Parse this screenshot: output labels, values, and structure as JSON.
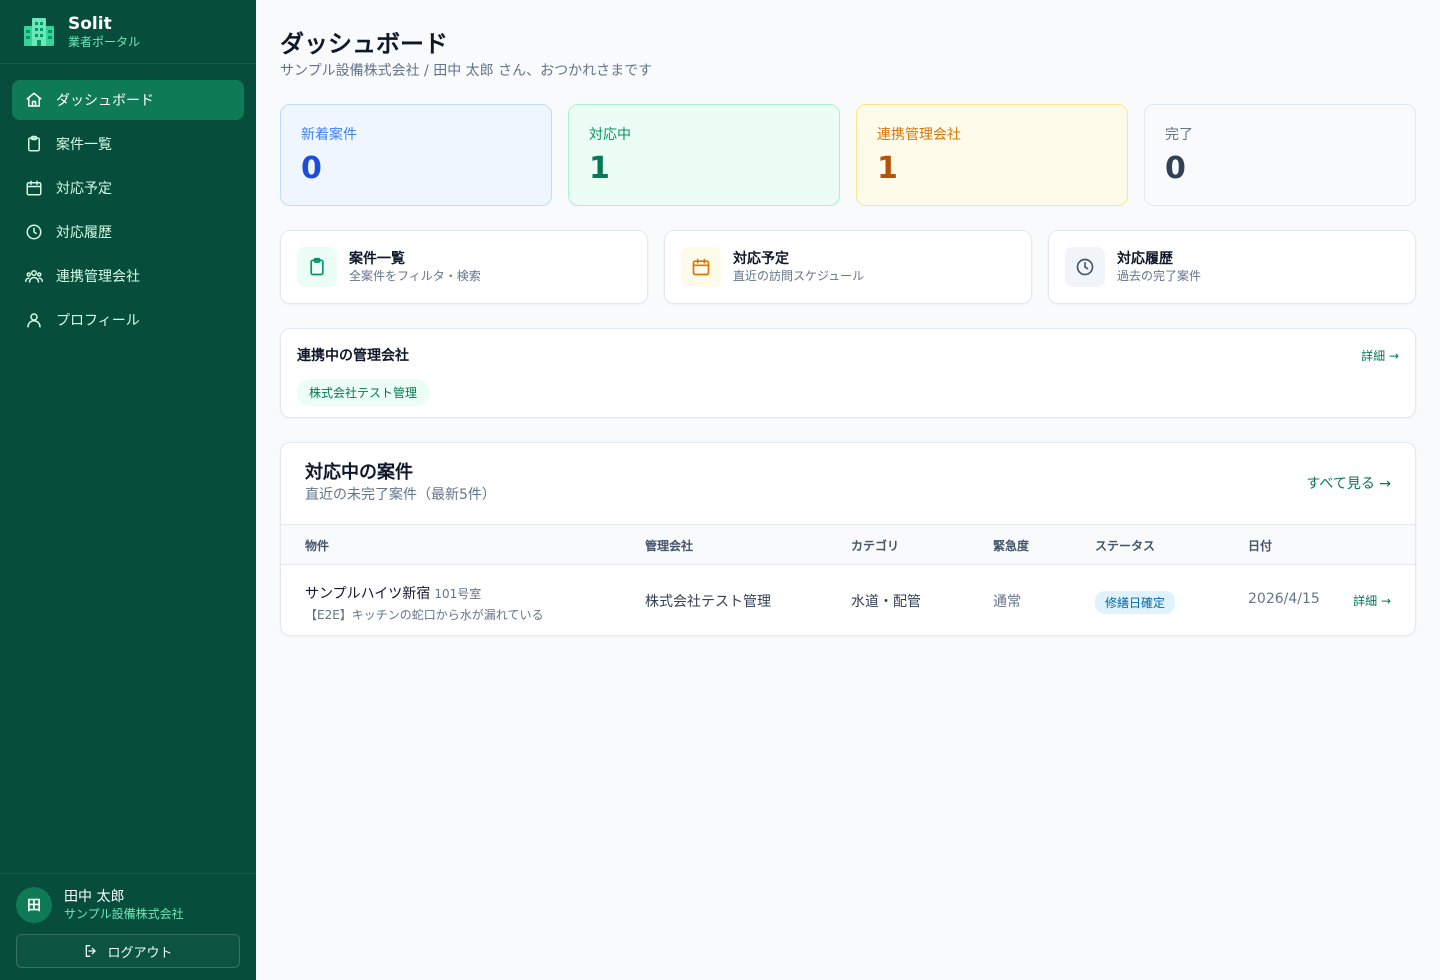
{
  "brand": {
    "name": "Solit",
    "subtitle": "業者ポータル"
  },
  "sidebar": {
    "items": [
      {
        "label": "ダッシュボード",
        "icon": "home-icon",
        "active": true
      },
      {
        "label": "案件一覧",
        "icon": "clipboard-icon"
      },
      {
        "label": "対応予定",
        "icon": "calendar-icon"
      },
      {
        "label": "対応履歴",
        "icon": "clock-icon"
      },
      {
        "label": "連携管理会社",
        "icon": "users-icon"
      },
      {
        "label": "プロフィール",
        "icon": "user-icon"
      }
    ]
  },
  "user": {
    "initial": "田",
    "name": "田中 太郎",
    "company": "サンプル設備株式会社",
    "logout_label": "ログアウト"
  },
  "header": {
    "title": "ダッシュボード",
    "subtitle": "サンプル設備株式会社 / 田中 太郎 さん、おつかれさまです"
  },
  "stats": [
    {
      "label": "新着案件",
      "value": "0",
      "color": "#1d4ed8"
    },
    {
      "label": "対応中",
      "value": "1",
      "color": "#047857"
    },
    {
      "label": "連携管理会社",
      "value": "1",
      "color": "#b45309"
    },
    {
      "label": "完了",
      "value": "0",
      "color": "#334155"
    }
  ],
  "quick_links": [
    {
      "title": "案件一覧",
      "subtitle": "全案件をフィルタ・検索",
      "icon": "clipboard-icon"
    },
    {
      "title": "対応予定",
      "subtitle": "直近の訪問スケジュール",
      "icon": "calendar-icon"
    },
    {
      "title": "対応履歴",
      "subtitle": "過去の完了案件",
      "icon": "clock-icon"
    }
  ],
  "partners": {
    "title": "連携中の管理会社",
    "link_label": "詳細 →",
    "chips": [
      "株式会社テスト管理"
    ]
  },
  "cases": {
    "title": "対応中の案件",
    "subtitle": "直近の未完了案件（最新5件）",
    "all_label": "すべて見る →",
    "columns": [
      "物件",
      "管理会社",
      "カテゴリ",
      "緊急度",
      "ステータス",
      "日付"
    ],
    "rows": [
      {
        "property": "サンプルハイツ新宿",
        "room": "101号室",
        "description": "【E2E】キッチンの蛇口から水が漏れている",
        "company": "株式会社テスト管理",
        "category": "水道・配管",
        "urgency": "通常",
        "status": "修繕日確定",
        "date": "2026/4/15",
        "link_label": "詳細 →"
      }
    ]
  },
  "colors": {
    "sidebar": "#064e3b",
    "accent": "#047857",
    "active_nav": "#0f7a56"
  }
}
